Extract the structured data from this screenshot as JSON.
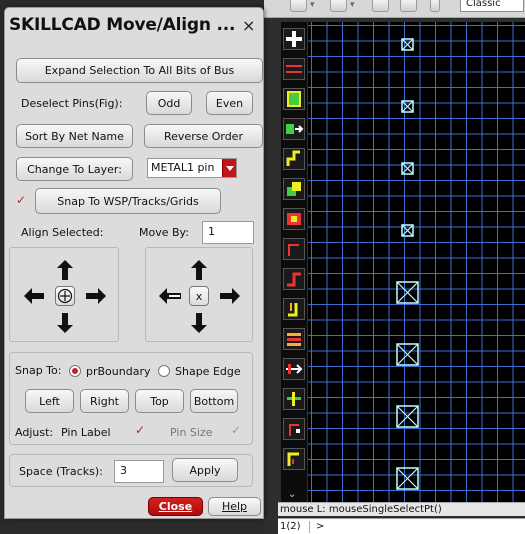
{
  "dialog": {
    "title": "SKILLCAD Move/Align ...",
    "close_glyph": "×",
    "expand_button": "Expand Selection To All Bits of Bus",
    "deselect_label": "Deselect Pins(Fig):",
    "odd_button": "Odd",
    "even_button": "Even",
    "sort_button": "Sort By Net Name",
    "reverse_button": "Reverse Order",
    "change_layer_button": "Change To Layer:",
    "layer_select": {
      "value": "METAL1 pin"
    },
    "snap_checkbox_checked": true,
    "snap_button": "Snap To WSP/Tracks/Grids",
    "align_label": "Align Selected:",
    "moveby_label": "Move By:",
    "moveby_value": "1",
    "align_pad": {
      "center_icon": "crosshair-circle-icon"
    },
    "move_pad": {
      "center_label": "x"
    },
    "snap_to_label": "Snap To:",
    "snap_options": [
      {
        "label": "prBoundary",
        "selected": true
      },
      {
        "label": "Shape Edge",
        "selected": false
      }
    ],
    "left_button": "Left",
    "right_button": "Right",
    "top_button": "Top",
    "bottom_button": "Bottom",
    "adjust_label": "Adjust:",
    "pin_label": {
      "label": "Pin Label",
      "checked": true
    },
    "pin_size": {
      "label": "Pin Size",
      "checked": true,
      "disabled": true
    },
    "space_label": "Space (Tracks):",
    "space_value": "3",
    "apply_button": "Apply",
    "close_button": "Close",
    "help_button": "Help"
  },
  "background": {
    "toolbar_combo": "Classic",
    "status_text": "mouse L: mouseSingleSelectPt()",
    "cmd_page": "1(2)",
    "cmd_prompt": ">",
    "more_glyph": "⌄"
  },
  "colors": {
    "accent_red": "#c01616",
    "grid_blue": "#4678e6",
    "pin_cyan": "#bfffff"
  }
}
